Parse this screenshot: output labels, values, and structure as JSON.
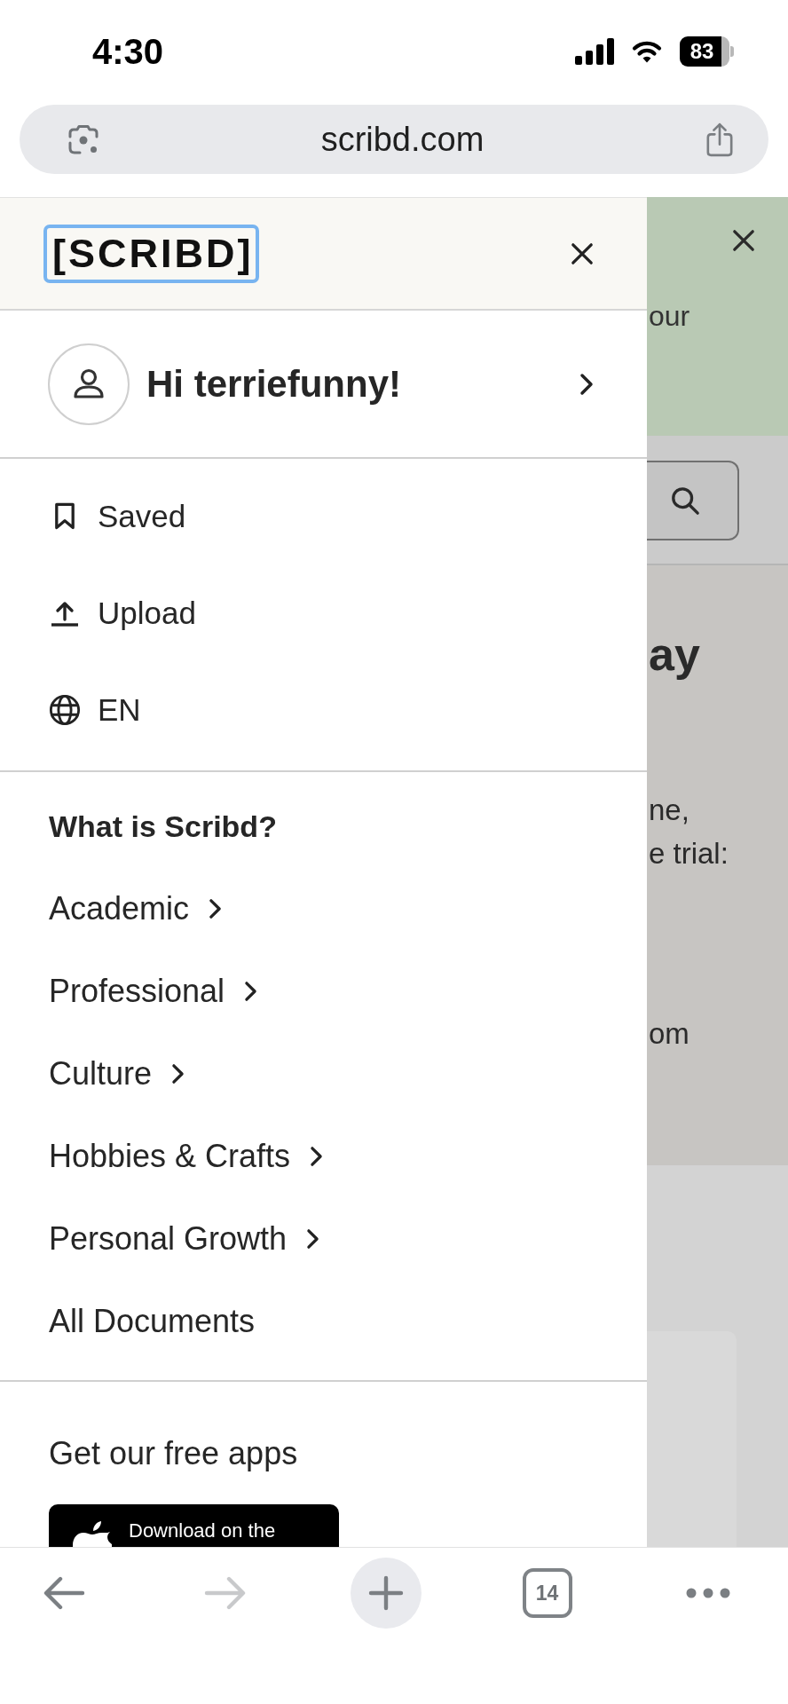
{
  "status_bar": {
    "time": "4:30",
    "battery": "83"
  },
  "address_bar": {
    "url": "scribd.com"
  },
  "background_page": {
    "banner_text": "our",
    "heading": "ay",
    "lines": [
      "ne,",
      "e trial:"
    ],
    "footer_text": "om"
  },
  "drawer": {
    "logo": {
      "text": "[SCRIBD]",
      "focused": true
    },
    "greeting": "Hi terriefunny!",
    "actions": [
      {
        "kind": "saved",
        "label": "Saved"
      },
      {
        "kind": "upload",
        "label": "Upload"
      },
      {
        "kind": "language",
        "label": "EN"
      }
    ],
    "section_title": "What is Scribd?",
    "categories": [
      {
        "label": "Academic",
        "has_submenu": true
      },
      {
        "label": "Professional",
        "has_submenu": true
      },
      {
        "label": "Culture",
        "has_submenu": true
      },
      {
        "label": "Hobbies & Crafts",
        "has_submenu": true
      },
      {
        "label": "Personal Growth",
        "has_submenu": true
      },
      {
        "label": "All Documents",
        "has_submenu": false
      }
    ],
    "apps_title": "Get our free apps",
    "app_badge": "Download on the"
  },
  "toolbar": {
    "buttons": [
      {
        "kind": "back",
        "disabled": false
      },
      {
        "kind": "forward",
        "disabled": true
      },
      {
        "kind": "new_tab",
        "disabled": false
      },
      {
        "kind": "tabs",
        "label": "14",
        "disabled": false
      },
      {
        "kind": "more",
        "disabled": false
      }
    ]
  }
}
